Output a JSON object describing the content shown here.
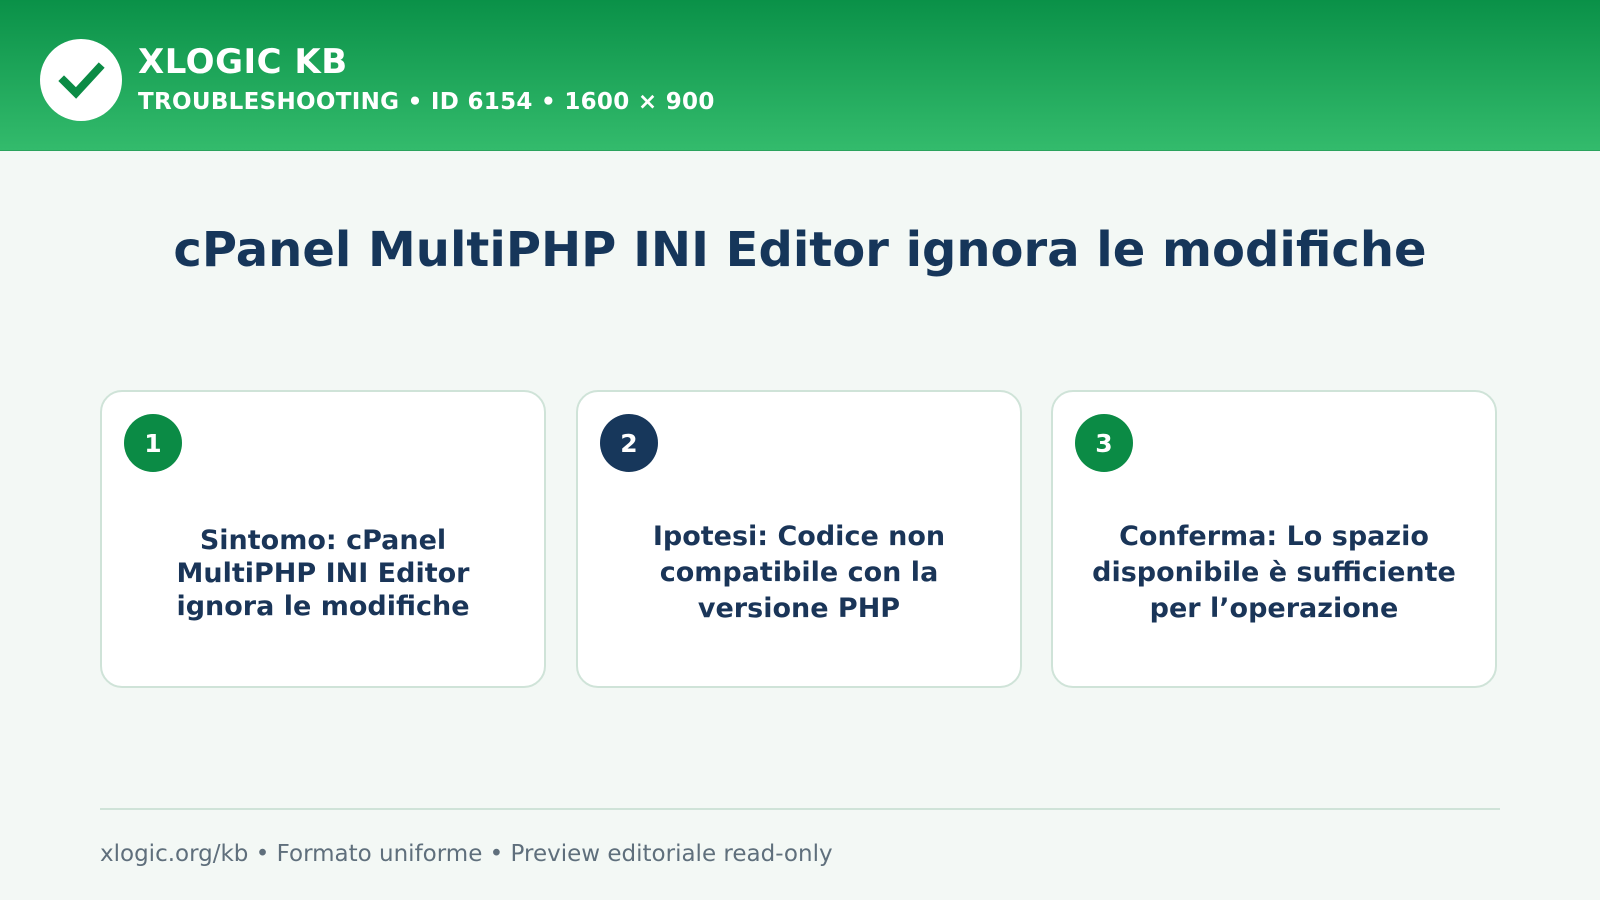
{
  "header": {
    "brand": "XLOGIC KB",
    "subtitle": "TROUBLESHOOTING • ID 6154 • 1600 × 900",
    "logo_icon": "checkmark-icon"
  },
  "main": {
    "title": "cPanel MultiPHP INI Editor ignora le modifiche",
    "cards": [
      {
        "number": "1",
        "text": "Sintomo: cPanel MultiPHP INI Editor ignora le modifiche",
        "badge_color": "#0b8b45"
      },
      {
        "number": "2",
        "text": "Ipotesi: Codice non compatibile con la versione PHP",
        "badge_color": "#17375b"
      },
      {
        "number": "3",
        "text": "Conferma: Lo spazio disponibile è sufficiente per l’operazione",
        "badge_color": "#0b8b45"
      }
    ]
  },
  "footer": {
    "text": "xlogic.org/kb • Formato uniforme • Preview editoriale read-only"
  },
  "colors": {
    "header_top": "#0a9148",
    "header_bottom": "#33bb6c",
    "title": "#16365a",
    "background": "#f3f8f5"
  }
}
